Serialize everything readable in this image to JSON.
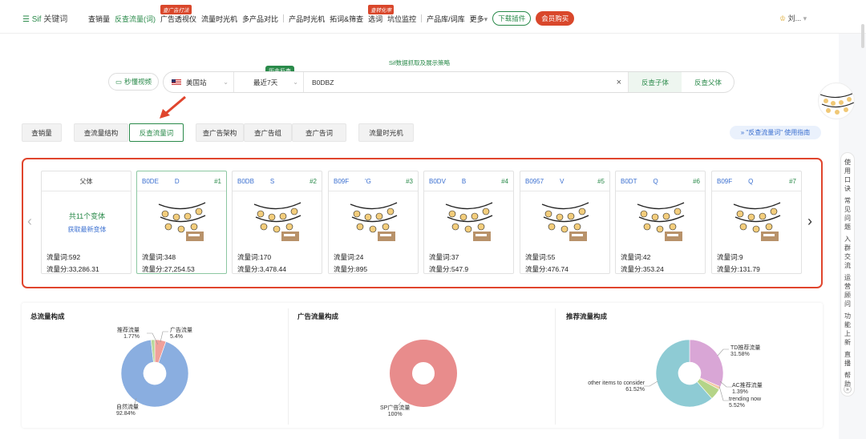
{
  "brand": {
    "logo": "Sif",
    "name": "关键词"
  },
  "nav": [
    {
      "label": "查销量"
    },
    {
      "label": "反查流量(词)",
      "active": true
    },
    {
      "label": "广告透视仪",
      "tag": "查广告打法"
    },
    {
      "label": "流量时光机"
    },
    {
      "label": "多产品对比"
    },
    {
      "label": "产品时光机"
    },
    {
      "label": "拓词&筛查"
    },
    {
      "label": "选词",
      "tag": "查转化率"
    },
    {
      "label": "坑位监控"
    },
    {
      "label": "产品库/词库"
    },
    {
      "label": "更多"
    }
  ],
  "download_btn": "下载插件",
  "vip_btn": "会员购买",
  "user": "刘...",
  "hint": "Sif数据抓取及展示策略",
  "history_tag": "历史反查",
  "video_btn": "秒懂视频",
  "search": {
    "site": "美国站",
    "range": "最近7天",
    "query": "B0DBZ",
    "btn_child": "反查子体",
    "btn_parent": "反查父体"
  },
  "tabs": [
    {
      "label": "查销量"
    },
    {
      "label": "查流量结构"
    },
    {
      "label": "反查流量词",
      "active": true
    },
    {
      "label": "查广告架构"
    },
    {
      "label": "查广告组"
    },
    {
      "label": "查广告词"
    },
    {
      "label": "流量时光机"
    }
  ],
  "guide": "\"反查流量词\" 使用指南",
  "parent_card": {
    "title": "父体",
    "variants": "共11个变体",
    "refresh": "获取最新变体",
    "m1": "流量词:592",
    "m2": "流量分:33,286.31"
  },
  "variants": [
    {
      "asin": "B0DE",
      "suffix": "D",
      "num": "#1",
      "m1": "流量词:348",
      "m2": "流量分:27,254.53"
    },
    {
      "asin": "B0DB",
      "suffix": "S",
      "num": "#2",
      "m1": "流量词:170",
      "m2": "流量分:3,478.44"
    },
    {
      "asin": "B09F",
      "suffix": "'G",
      "num": "#3",
      "m1": "流量词:24",
      "m2": "流量分:895"
    },
    {
      "asin": "B0DV",
      "suffix": "B",
      "num": "#4",
      "m1": "流量词:37",
      "m2": "流量分:547.9"
    },
    {
      "asin": "B0957",
      "suffix": "V",
      "num": "#5",
      "m1": "流量词:55",
      "m2": "流量分:476.74"
    },
    {
      "asin": "B0DT",
      "suffix": "Q",
      "num": "#6",
      "m1": "流量词:42",
      "m2": "流量分:353.24"
    },
    {
      "asin": "B09F",
      "suffix": "Q",
      "num": "#7",
      "m1": "流量词:9",
      "m2": "流量分:131.79"
    }
  ],
  "panels": {
    "total": "总流量构成",
    "ad": "广告流量构成",
    "rec": "推荐流量构成"
  },
  "chart_data": [
    {
      "type": "pie",
      "title": "总流量构成",
      "slices": [
        {
          "name": "自然流量",
          "value": 92.84,
          "color": "#8aaee0"
        },
        {
          "name": "广告流量",
          "value": 5.4,
          "color": "#f0a09a"
        },
        {
          "name": "推荐流量",
          "value": 1.77,
          "color": "#b8d89a"
        }
      ]
    },
    {
      "type": "pie",
      "title": "广告流量构成",
      "slices": [
        {
          "name": "SP广告流量",
          "value": 100,
          "color": "#e88c8c"
        }
      ]
    },
    {
      "type": "pie",
      "title": "推荐流量构成",
      "slices": [
        {
          "name": "TD推荐流量",
          "value": 31.58,
          "color": "#d9a6d6"
        },
        {
          "name": "AC推荐流量",
          "value": 1.39,
          "color": "#f4c9a4"
        },
        {
          "name": "trending now",
          "value": 5.52,
          "color": "#b4d488"
        },
        {
          "name": "other items to consider",
          "value": 61.52,
          "color": "#8ecbd4"
        }
      ]
    }
  ],
  "labels": {
    "t_rec": "推荐流量",
    "t_rec_v": "1.77%",
    "t_ad": "广告流量",
    "t_ad_v": "5.4%",
    "t_nat": "自然流量",
    "t_nat_v": "92.84%",
    "a_sp": "SP广告流量",
    "a_sp_v": "100%",
    "r_td": "TD推荐流量",
    "r_td_v": "31.58%",
    "r_ac": "AC推荐流量",
    "r_ac_v": "1.39%",
    "r_tn": "trending now",
    "r_tn_v": "5.52%",
    "r_ot": "other items to consider",
    "r_ot_v": "61.52%"
  },
  "sidebar": [
    "使用口诀",
    "常见问题",
    "入群交流",
    "运营顾问",
    "功能上新",
    "直播",
    "帮助"
  ]
}
